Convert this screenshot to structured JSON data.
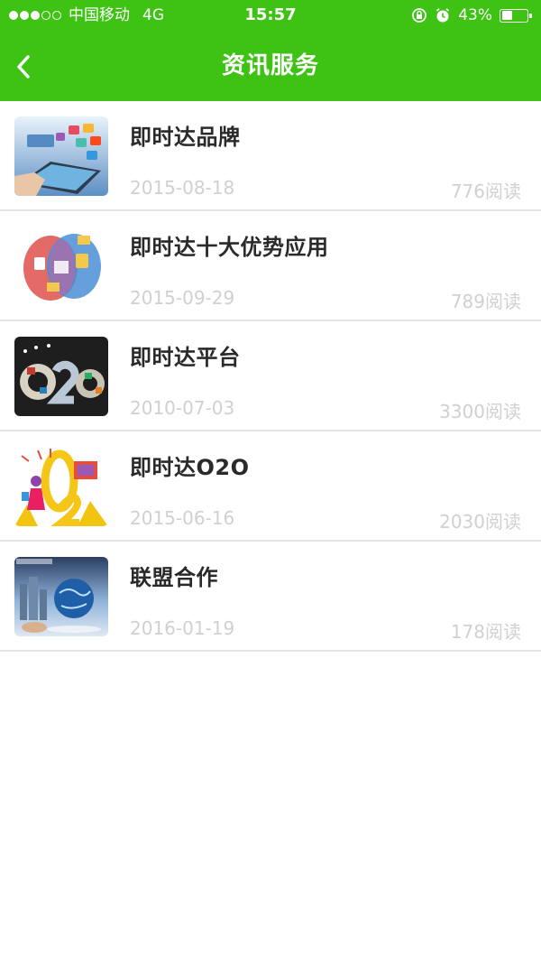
{
  "status_bar": {
    "carrier": "中国移动",
    "network": "4G",
    "time": "15:57",
    "battery": "43%",
    "battery_level": 0.43
  },
  "nav": {
    "title": "资讯服务",
    "back_icon": "chevron-left-icon"
  },
  "colors": {
    "header_bg": "#3ec214",
    "title_text": "#2a2a2a",
    "meta_text": "#d0d0d0",
    "divider": "#e4e4e4"
  },
  "articles": [
    {
      "title": "即时达品牌",
      "date": "2015-08-18",
      "reads": "776阅读",
      "thumbnail": "tablet-apps-image"
    },
    {
      "title": "即时达十大优势应用",
      "date": "2015-09-29",
      "reads": "789阅读",
      "thumbnail": "o2o-venn-image"
    },
    {
      "title": "即时达平台",
      "date": "2010-07-03",
      "reads": "3300阅读",
      "thumbnail": "o2o-collage-image"
    },
    {
      "title": "即时达O2O",
      "date": "2015-06-16",
      "reads": "2030阅读",
      "thumbnail": "o2o-shopping-image"
    },
    {
      "title": "联盟合作",
      "date": "2016-01-19",
      "reads": "178阅读",
      "thumbnail": "business-globe-image"
    }
  ]
}
